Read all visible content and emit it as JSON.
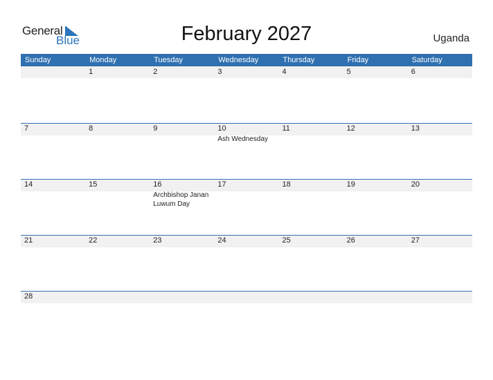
{
  "logo": {
    "general": "General",
    "blue": "Blue",
    "icon": "triangle-flag-icon",
    "brand_color": "#2a74bb"
  },
  "title": "February 2027",
  "country": "Uganda",
  "colors": {
    "header_bg": "#2f70b0",
    "strip_bg": "#f1f1f1"
  },
  "weekdays": [
    "Sunday",
    "Monday",
    "Tuesday",
    "Wednesday",
    "Thursday",
    "Friday",
    "Saturday"
  ],
  "weeks": [
    [
      {
        "day": ""
      },
      {
        "day": "1"
      },
      {
        "day": "2"
      },
      {
        "day": "3"
      },
      {
        "day": "4"
      },
      {
        "day": "5"
      },
      {
        "day": "6"
      }
    ],
    [
      {
        "day": "7"
      },
      {
        "day": "8"
      },
      {
        "day": "9"
      },
      {
        "day": "10",
        "event": "Ash Wednesday"
      },
      {
        "day": "11"
      },
      {
        "day": "12"
      },
      {
        "day": "13"
      }
    ],
    [
      {
        "day": "14"
      },
      {
        "day": "15"
      },
      {
        "day": "16",
        "event": "Archbishop Janan Luwum Day"
      },
      {
        "day": "17"
      },
      {
        "day": "18"
      },
      {
        "day": "19"
      },
      {
        "day": "20"
      }
    ],
    [
      {
        "day": "21"
      },
      {
        "day": "22"
      },
      {
        "day": "23"
      },
      {
        "day": "24"
      },
      {
        "day": "25"
      },
      {
        "day": "26"
      },
      {
        "day": "27"
      }
    ],
    [
      {
        "day": "28"
      },
      {
        "day": ""
      },
      {
        "day": ""
      },
      {
        "day": ""
      },
      {
        "day": ""
      },
      {
        "day": ""
      },
      {
        "day": ""
      }
    ]
  ]
}
